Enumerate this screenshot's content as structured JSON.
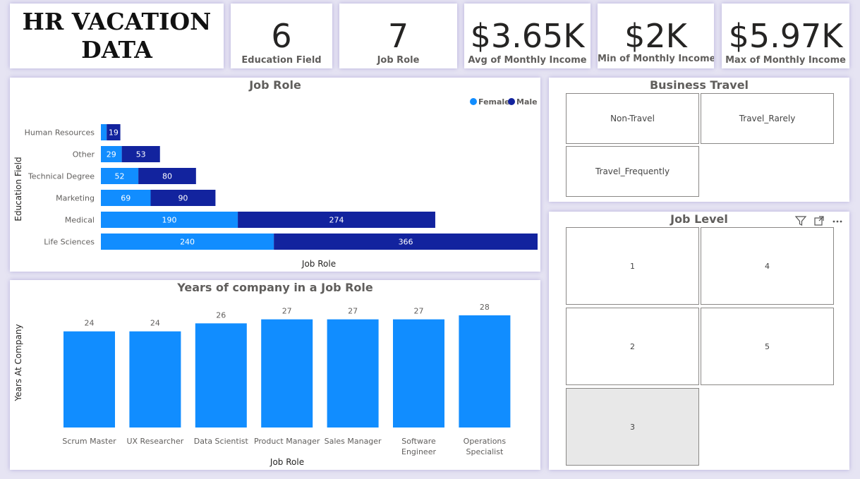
{
  "header": {
    "title_line1": "HR VACATION",
    "title_line2": "DATA"
  },
  "kpis": [
    {
      "value": "6",
      "label": "Education Field"
    },
    {
      "value": "7",
      "label": "Job Role"
    },
    {
      "value": "$3.65K",
      "label": "Avg of  Monthly Income"
    },
    {
      "value": "$2K",
      "label": "Min of  Monthly Income"
    },
    {
      "value": "$5.97K",
      "label": "Max of  Monthly Income"
    }
  ],
  "colors": {
    "female": "#118DFF",
    "male": "#12239E",
    "bar": "#118DFF"
  },
  "job_role_chart": {
    "title": "Job Role",
    "xlabel": "Job Role",
    "ylabel": "Education Field",
    "legend": [
      "Female",
      "Male"
    ]
  },
  "years_chart": {
    "title": "Years of company in a Job Role",
    "xlabel": "Job Role",
    "ylabel": "Years At Company"
  },
  "business_travel": {
    "title": "Business Travel",
    "options": [
      "Non-Travel",
      "Travel_Rarely",
      "Travel_Frequently"
    ]
  },
  "job_level": {
    "title": "Job Level",
    "options": [
      "1",
      "4",
      "2",
      "5",
      "3"
    ],
    "selected": "3"
  },
  "chart_data": [
    {
      "type": "bar",
      "orientation": "horizontal",
      "stacked": true,
      "title": "Job Role",
      "xlabel": "Job Role",
      "ylabel": "Education Field",
      "legend_position": "top-right",
      "categories": [
        "Human Resources",
        "Other",
        "Technical Degree",
        "Marketing",
        "Medical",
        "Life Sciences"
      ],
      "series": [
        {
          "name": "Female",
          "values": [
            8,
            29,
            52,
            69,
            190,
            240
          ]
        },
        {
          "name": "Male",
          "values": [
            19,
            53,
            80,
            90,
            274,
            366
          ]
        }
      ],
      "data_labels": {
        "Female": [
          "",
          "29",
          "52",
          "69",
          "190",
          "240"
        ],
        "Male": [
          "19",
          "53",
          "80",
          "90",
          "274",
          "366"
        ]
      },
      "xlim": [
        0,
        606
      ]
    },
    {
      "type": "bar",
      "orientation": "vertical",
      "title": "Years of company in a Job Role",
      "xlabel": "Job Role",
      "ylabel": "Years At Company",
      "categories": [
        "Scrum Master",
        "UX Researcher",
        "Data Scientist",
        "Product Manager",
        "Sales Manager",
        "Software Engineer",
        "Operations Specialist"
      ],
      "values": [
        24,
        24,
        26,
        27,
        27,
        27,
        28
      ],
      "ylim": [
        0,
        28
      ]
    }
  ]
}
